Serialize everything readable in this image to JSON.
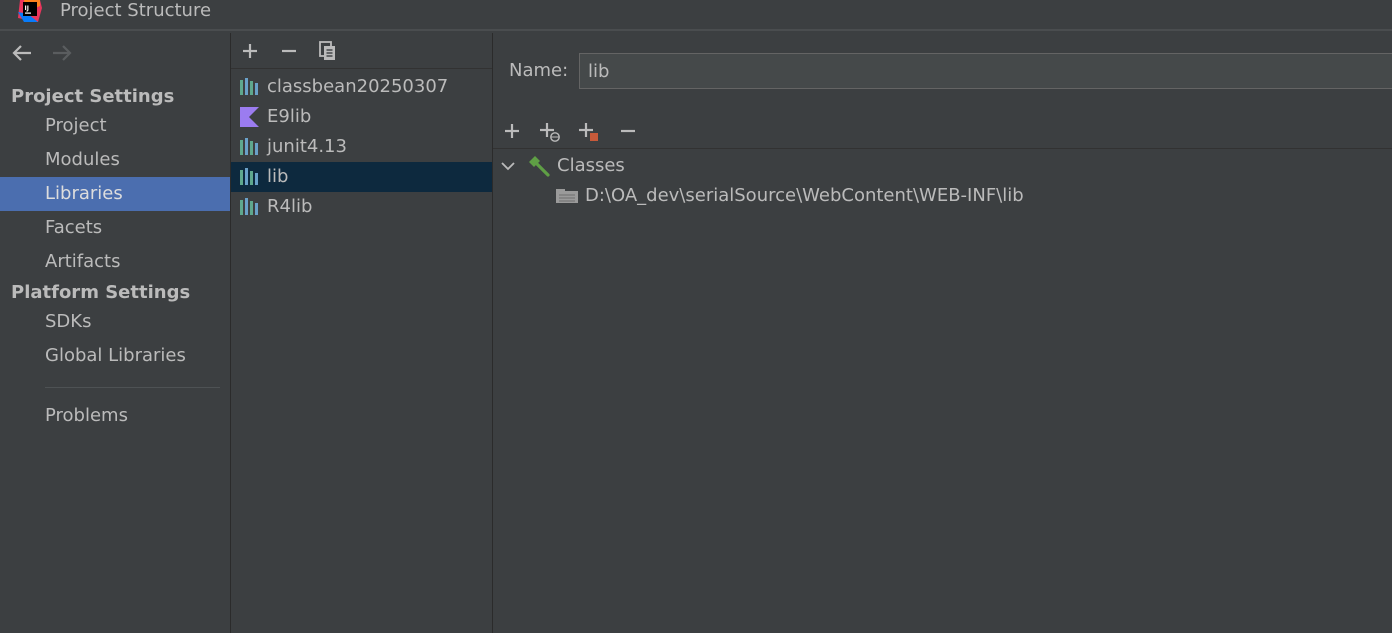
{
  "window": {
    "title": "Project Structure"
  },
  "sidebar": {
    "project_settings_title": "Project Settings",
    "platform_settings_title": "Platform Settings",
    "items": [
      {
        "label": "Project"
      },
      {
        "label": "Modules"
      },
      {
        "label": "Libraries"
      },
      {
        "label": "Facets"
      },
      {
        "label": "Artifacts"
      },
      {
        "label": "SDKs"
      },
      {
        "label": "Global Libraries"
      },
      {
        "label": "Problems"
      }
    ],
    "selected": "Libraries"
  },
  "libraries": {
    "items": [
      {
        "label": "classbean20250307",
        "icon": "java-library-icon"
      },
      {
        "label": "E9lib",
        "icon": "kotlin-library-icon"
      },
      {
        "label": "junit4.13",
        "icon": "java-library-icon"
      },
      {
        "label": "lib",
        "icon": "java-library-icon"
      },
      {
        "label": "R4lib",
        "icon": "java-library-icon"
      }
    ],
    "selected": "lib"
  },
  "detail": {
    "name_label": "Name:",
    "name_value": "lib",
    "tree": {
      "classes_label": "Classes",
      "path": "D:\\OA_dev\\serialSource\\WebContent\\WEB-INF\\lib"
    }
  },
  "colors": {
    "background": "#3c3f41",
    "selection_active": "#4b6eaf",
    "selection_inactive": "#0d293e",
    "text": "#bbbbbb",
    "library_green": "#5fa88e",
    "kotlin_purple": "#9b7cf0",
    "hammer_green": "#5f9f45",
    "add_badge_orange": "#c75a3a"
  }
}
